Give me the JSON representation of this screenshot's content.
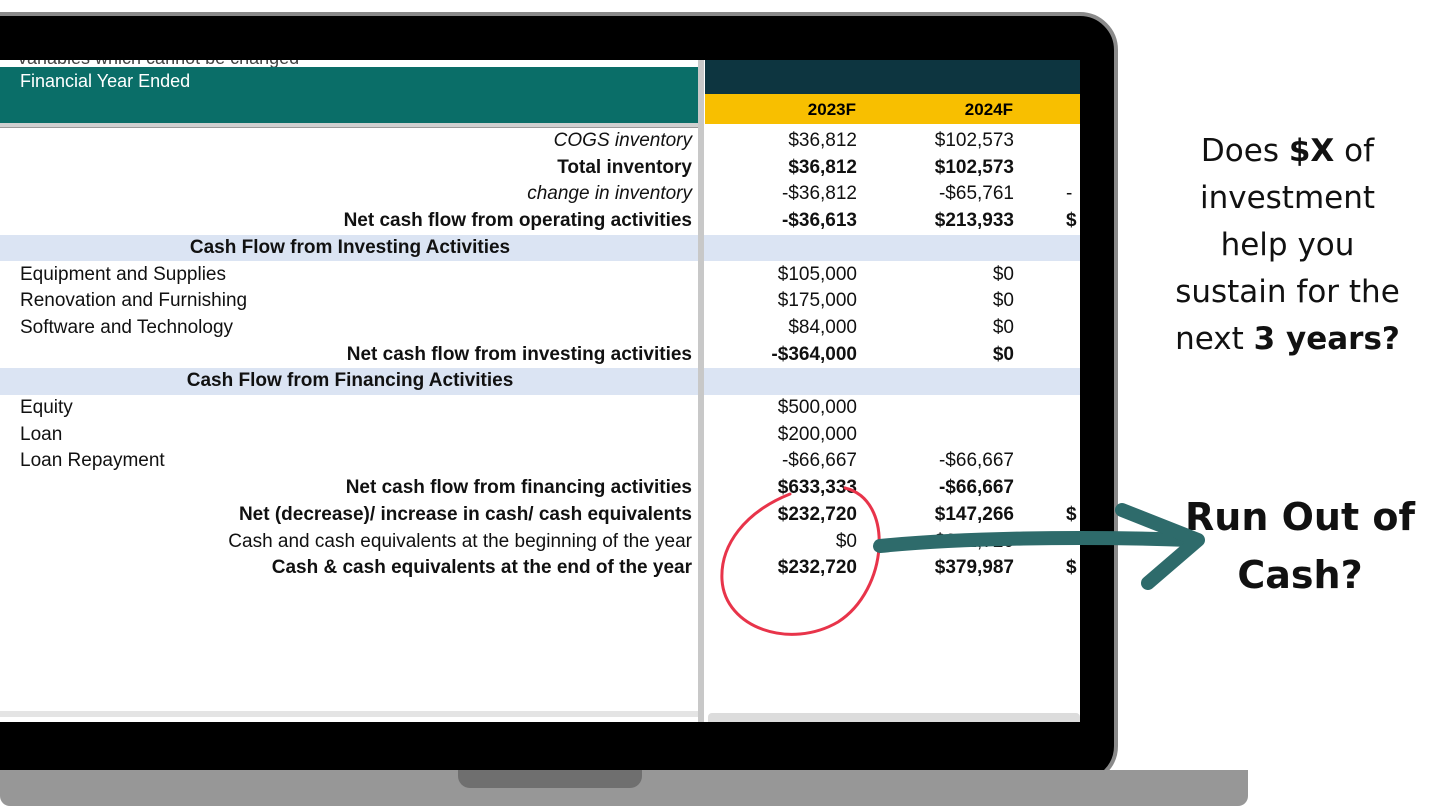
{
  "sheet": {
    "cut_text": "variables which cannot be changed",
    "header_label": "Financial Year Ended",
    "years": [
      "2023F",
      "2024F"
    ],
    "rows": [
      {
        "label": "COGS inventory",
        "style": "italic",
        "align": "right",
        "v1": "$36,812",
        "v2": "$102,573",
        "v3": ""
      },
      {
        "label": "Total inventory",
        "style": "bold",
        "align": "right",
        "v1": "$36,812",
        "v2": "$102,573",
        "v3": ""
      },
      {
        "label": "change in inventory",
        "style": "italic",
        "align": "right",
        "v1": "-$36,812",
        "v2": "-$65,761",
        "v3": "-"
      },
      {
        "label": "Net cash flow from operating activities",
        "style": "bold",
        "align": "right",
        "v1": "-$36,613",
        "v2": "$213,933",
        "v3": "$"
      },
      {
        "label": "Cash Flow from Investing Activities",
        "style": "bold",
        "align": "center",
        "band": true,
        "v1": "",
        "v2": "",
        "v3": ""
      },
      {
        "label": "Equipment and Supplies",
        "style": "normal",
        "align": "left",
        "v1": "$105,000",
        "v2": "$0",
        "v3": ""
      },
      {
        "label": "Renovation and Furnishing",
        "style": "normal",
        "align": "left",
        "v1": "$175,000",
        "v2": "$0",
        "v3": ""
      },
      {
        "label": "Software and Technology",
        "style": "normal",
        "align": "left",
        "v1": "$84,000",
        "v2": "$0",
        "v3": ""
      },
      {
        "label": "Net cash flow from investing activities",
        "style": "bold",
        "align": "right",
        "v1": "-$364,000",
        "v2": "$0",
        "v3": ""
      },
      {
        "label": "Cash Flow from Financing Activities",
        "style": "bold",
        "align": "center",
        "band": true,
        "v1": "",
        "v2": "",
        "v3": ""
      },
      {
        "label": "Equity",
        "style": "normal",
        "align": "left",
        "v1": "$500,000",
        "v2": "",
        "v3": ""
      },
      {
        "label": "Loan",
        "style": "normal",
        "align": "left",
        "v1": "$200,000",
        "v2": "",
        "v3": ""
      },
      {
        "label": "Loan Repayment",
        "style": "normal",
        "align": "left",
        "v1": "-$66,667",
        "v2": "-$66,667",
        "v3": ""
      },
      {
        "label": "Net cash flow from financing activities",
        "style": "bold",
        "align": "right",
        "v1": "$633,333",
        "v2": "-$66,667",
        "v3": ""
      },
      {
        "label": "Net (decrease)/ increase in cash/ cash equivalents",
        "style": "bold",
        "align": "right",
        "v1": "$232,720",
        "v2": "$147,266",
        "v3": "$"
      },
      {
        "label": "Cash and cash equivalents at the beginning of the year",
        "style": "normal",
        "align": "right",
        "v1": "$0",
        "v2": "$232,720",
        "v3": ""
      },
      {
        "label": "Cash & cash equivalents at the end of the year",
        "style": "bold",
        "align": "right",
        "v1": "$232,720",
        "v2": "$379,987",
        "v3": "$"
      }
    ]
  },
  "aside": {
    "question_line1_pre": "Does ",
    "question_line1_bold": "$X",
    "question_line1_post": " of",
    "question_line2": "investment",
    "question_line3": "help you",
    "question_line4": "sustain for the",
    "question_line5_pre": "next ",
    "question_line5_bold": "3 years?",
    "cta_line1": "Run Out of",
    "cta_line2": "Cash?"
  },
  "colors": {
    "header_teal": "#0a6e68",
    "header_dark": "#0d3540",
    "header_yellow": "#f8bf00",
    "band_blue": "#dbe4f3",
    "circle_red": "#e8344a",
    "arrow_teal": "#2e6b6b"
  }
}
